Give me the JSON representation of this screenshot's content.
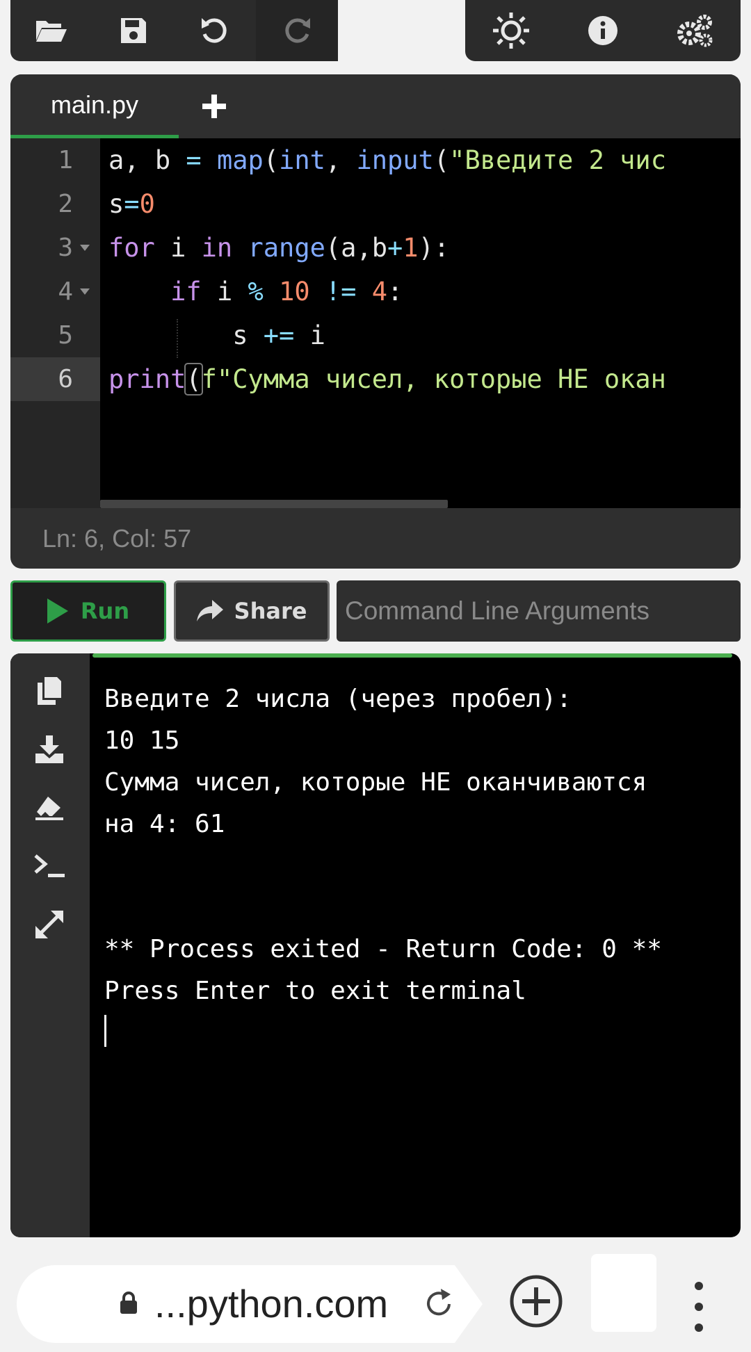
{
  "toolbar": {
    "left_icons": [
      "open-folder-icon",
      "save-icon",
      "undo-icon",
      "redo-icon"
    ],
    "right_icons": [
      "theme-icon",
      "info-icon",
      "settings-icon"
    ]
  },
  "editor": {
    "tabs": [
      {
        "label": "main.py",
        "active": true
      }
    ],
    "add_tab_icon": "plus-icon",
    "line_numbers": [
      "1",
      "2",
      "3",
      "4",
      "5",
      "6"
    ],
    "lines": [
      "a, b = map(int, input(\"Введите 2 чис",
      "s=0",
      "for i in range(a,b+1):",
      "    if i % 10 != 4:",
      "        s += i",
      "print(f\"Сумма чисел, которые НЕ окан"
    ],
    "status": "Ln: 6,  Col: 57"
  },
  "actions": {
    "run_label": "Run",
    "share_label": "Share",
    "args_placeholder": "Command Line Arguments",
    "args_value": ""
  },
  "terminal": {
    "side_icons": [
      "copy-icon",
      "download-icon",
      "clear-icon",
      "terminal-icon",
      "expand-icon"
    ],
    "output": [
      "Введите 2 числа (через пробел):",
      "10 15",
      "Сумма чисел, которые НЕ оканчиваются",
      "на 4: 61",
      "",
      "",
      "** Process exited - Return Code: 0 **",
      "Press Enter to exit terminal"
    ]
  },
  "browser": {
    "url": "...python.com"
  },
  "colors": {
    "accent_green": "#2e9e48",
    "panel_bg": "#2f2f2f",
    "terminal_bg": "#000000"
  }
}
